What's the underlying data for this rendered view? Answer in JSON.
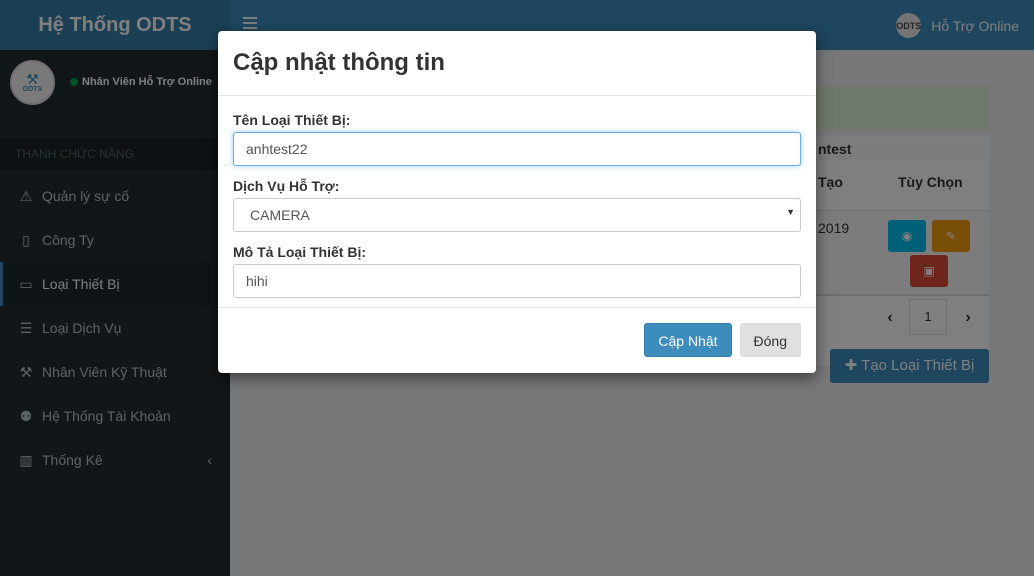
{
  "app": {
    "brand": "Hệ Thống ODTS",
    "support_label": "Hỗ Trợ Online",
    "avatar_abbr": "ODTS"
  },
  "user": {
    "status": "Nhân Viên Hỗ Trợ Online"
  },
  "sidebar": {
    "header": "THANH CHỨC NĂNG",
    "items": [
      {
        "label": "Quản lý sự cố",
        "icon": "warning-icon",
        "glyph": "⚠"
      },
      {
        "label": "Công Ty",
        "icon": "building-icon",
        "glyph": "▯"
      },
      {
        "label": "Loại Thiết Bị",
        "icon": "monitor-icon",
        "glyph": "▭",
        "active": true
      },
      {
        "label": "Loại Dịch Vụ",
        "icon": "list-icon",
        "glyph": "☰"
      },
      {
        "label": "Nhân Viên Kỹ Thuật",
        "icon": "wrench-icon",
        "glyph": "⚒"
      },
      {
        "label": "Hệ Thống Tài Khoản",
        "icon": "users-icon",
        "glyph": "👥"
      },
      {
        "label": "Thống Kê",
        "icon": "bar-chart-icon",
        "glyph": "▥",
        "has_caret": true
      }
    ],
    "caret": "‹"
  },
  "content": {
    "filter_text": "ntest",
    "col_created": "Tạo",
    "col_options": "Tùy Chọn",
    "row_year": "2019",
    "page_number": "1",
    "prev": "‹",
    "next": "›",
    "create_button": "✚ Tạo Loại Thiết Bị"
  },
  "modal": {
    "title": "Cập nhật thông tin",
    "device_type_label": "Tên Loại Thiết Bị:",
    "device_type_value": "anhtest22",
    "service_label": "Dịch Vụ Hỗ Trợ:",
    "service_value": "CAMERA",
    "description_label": "Mô Tả Loại Thiết Bị:",
    "description_value": "hihi",
    "update_button": "Cập Nhật",
    "close_button": "Đóng"
  },
  "colors": {
    "primary": "#3c8dbc",
    "sidebar": "#222d32",
    "info": "#00c0ef",
    "warning": "#f39c12",
    "danger": "#dd4b39"
  }
}
